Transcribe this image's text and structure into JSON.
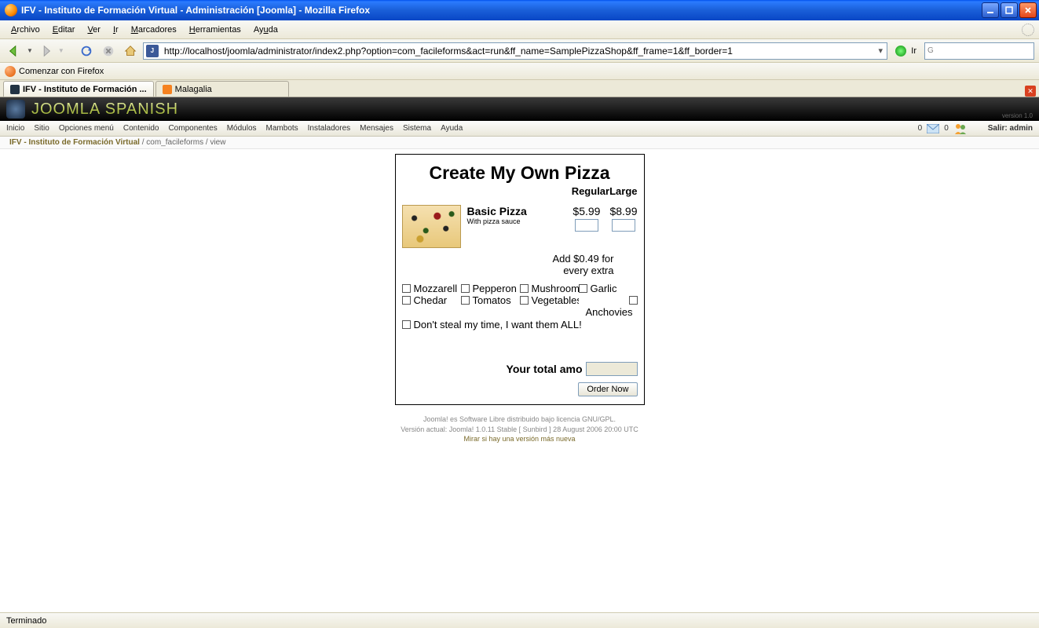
{
  "window": {
    "title": "IFV - Instituto de Formación Virtual - Administración [Joomla] - Mozilla Firefox"
  },
  "ff_menu": {
    "items": [
      "Archivo",
      "Editar",
      "Ver",
      "Ir",
      "Marcadores",
      "Herramientas",
      "Ayuda"
    ]
  },
  "nav": {
    "url": "http://localhost/joomla/administrator/index2.php?option=com_facileforms&act=run&ff_name=SamplePizzaShop&ff_frame=1&ff_border=1",
    "go_label": "Ir"
  },
  "bookmarks": {
    "item0": "Comenzar con Firefox"
  },
  "tabs": {
    "t0": "IFV - Instituto de Formación ...",
    "t1": "Malagalia"
  },
  "joomla": {
    "brand": "JOOMLA SPANISH",
    "version": "version 1.0",
    "menu": [
      "Inicio",
      "Sitio",
      "Opciones menú",
      "Contenido",
      "Componentes",
      "Módulos",
      "Mambots",
      "Instaladores",
      "Mensajes",
      "Sistema",
      "Ayuda"
    ],
    "mail_count": "0",
    "user_count": "0",
    "logout": "Salir: admin"
  },
  "breadcrumb": {
    "l1": "IFV - Instituto de Formación Virtual",
    "sep1": " / ",
    "l2": "com_facileforms",
    "sep2": " / ",
    "l3": "view"
  },
  "pizza": {
    "title": "Create My Own Pizza",
    "size_regular": "Regular",
    "size_large": "Large",
    "basic_name": "Basic Pizza",
    "basic_sub": "With pizza sauce",
    "price_regular": "$5.99",
    "price_large": "$8.99",
    "extra_note_l1": "Add $0.49 for",
    "extra_note_l2": "every extra",
    "toppings": {
      "t0": "Mozzarell",
      "t1": "Pepperon",
      "t2": "Mushroom",
      "t3": "Garlic",
      "t4": "Chedar",
      "t5": "Tomatos",
      "t6": "Vegetables",
      "t7": "Anchovies"
    },
    "all_label": "Don't steal my time, I want them ALL!",
    "total_label": "Your total amo",
    "order_btn": "Order Now"
  },
  "footer": {
    "l1": "Joomla! es Software Libre distribuido bajo licencia GNU/GPL.",
    "l2": "Versión actual: Joomla! 1.0.11 Stable [ Sunbird ] 28 August 2006 20:00 UTC",
    "l3": "Mirar si hay una versión más nueva"
  },
  "status": {
    "text": "Terminado"
  }
}
